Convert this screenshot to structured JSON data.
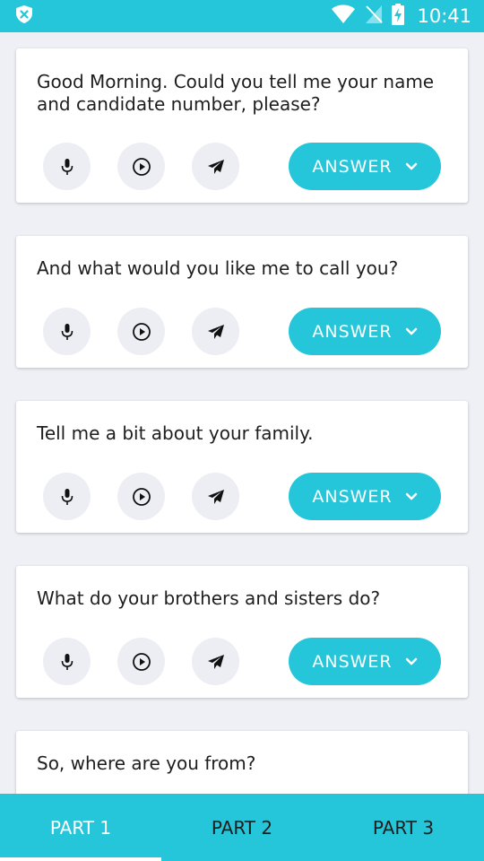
{
  "status_bar": {
    "time": "10:41",
    "icons": [
      "app-shield-icon",
      "wifi-icon",
      "no-signal-icon",
      "battery-charging-icon"
    ],
    "color": "#26c6da"
  },
  "answer_label": "ANSWER",
  "questions": [
    {
      "lines": [
        "Good Morning. Could you tell me your name",
        "and candidate number, please?"
      ]
    },
    {
      "lines": [
        "And what would you like me to call you?"
      ]
    },
    {
      "lines": [
        "Tell me a bit about your family."
      ]
    },
    {
      "lines": [
        "What do your brothers and sisters do?"
      ]
    },
    {
      "lines": [
        "So, where are you from?"
      ]
    }
  ],
  "tabs": [
    {
      "label": "PART 1",
      "active": true
    },
    {
      "label": "PART 2",
      "active": false
    },
    {
      "label": "PART 3",
      "active": false
    }
  ],
  "colors": {
    "accent": "#26c6da",
    "background": "#eef0f5"
  }
}
